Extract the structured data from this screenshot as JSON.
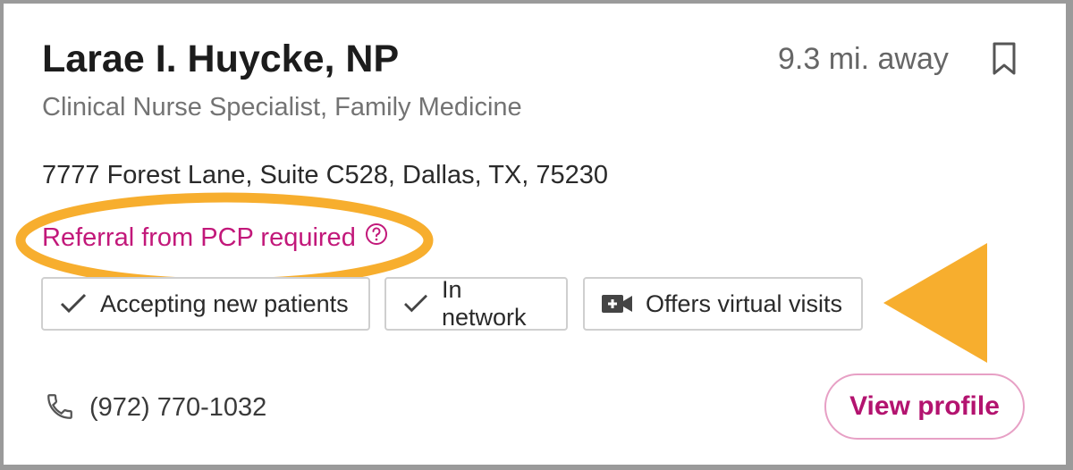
{
  "provider": {
    "name": "Larae I. Huycke, NP",
    "distance": "9.3 mi. away",
    "specialty": "Clinical Nurse Specialist, Family Medicine",
    "address": "7777 Forest Lane, Suite C528, Dallas, TX, 75230",
    "referral": "Referral from PCP required",
    "phone": "(972) 770-1032"
  },
  "badges": [
    {
      "icon": "checkmark-icon",
      "label": "Accepting new patients"
    },
    {
      "icon": "checkmark-icon",
      "label": "In network"
    },
    {
      "icon": "video-camera-icon",
      "label": "Offers virtual visits"
    }
  ],
  "actions": {
    "view_profile_label": "View profile",
    "bookmark_icon": "bookmark-icon"
  },
  "colors": {
    "accent_magenta": "#c2187a",
    "annotation_orange": "#f7ae2e",
    "badge_border": "#cfcfcf"
  }
}
